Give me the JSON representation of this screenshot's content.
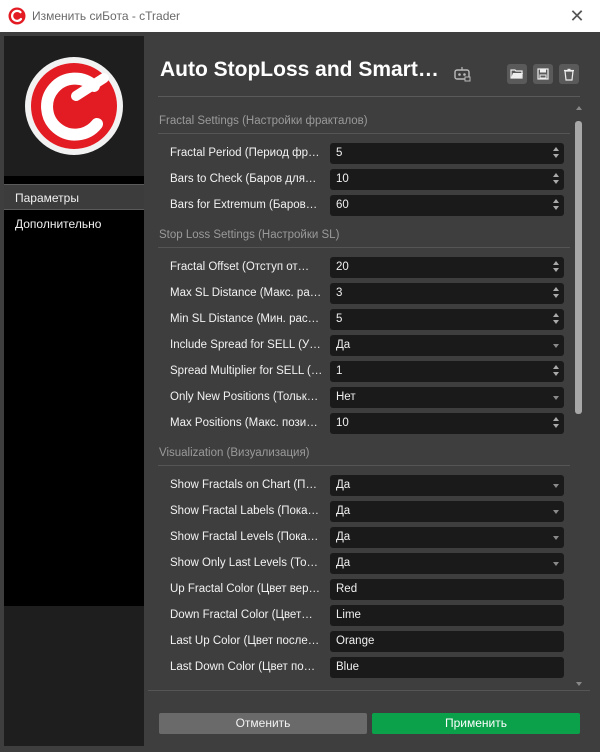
{
  "window": {
    "title": "Изменить сиБота - cTrader"
  },
  "sidebar": {
    "items": [
      {
        "label": "Параметры",
        "active": true
      },
      {
        "label": "Дополнительно",
        "active": false
      }
    ]
  },
  "header": {
    "title": "Auto StopLoss and Smart…"
  },
  "sections": {
    "fractal": {
      "title": "Fractal Settings (Настройки фракталов)",
      "rows": [
        {
          "label": "Fractal Period (Период фра…",
          "value": "5",
          "control": "spin"
        },
        {
          "label": "Bars to Check (Баров для…",
          "value": "10",
          "control": "spin"
        },
        {
          "label": "Bars for Extremum (Баров…",
          "value": "60",
          "control": "spin"
        }
      ]
    },
    "stoploss": {
      "title": "Stop Loss Settings (Настройки SL)",
      "rows": [
        {
          "label": "Fractal Offset (Отступ от…",
          "value": "20",
          "control": "spin"
        },
        {
          "label": "Max SL Distance (Макс. ра…",
          "value": "3",
          "control": "spin"
        },
        {
          "label": "Min SL Distance (Мин. рас…",
          "value": "5",
          "control": "spin"
        },
        {
          "label": "Include Spread for SELL (У…",
          "value": "Да",
          "control": "select"
        },
        {
          "label": "Spread Multiplier for SELL (…",
          "value": "1",
          "control": "spin"
        },
        {
          "label": "Only New Positions (Тольк…",
          "value": "Нет",
          "control": "select"
        },
        {
          "label": "Max Positions (Макс. позиц…",
          "value": "10",
          "control": "spin"
        }
      ]
    },
    "visualization": {
      "title": "Visualization (Визуализация)",
      "rows": [
        {
          "label": "Show Fractals on Chart (П…",
          "value": "Да",
          "control": "select"
        },
        {
          "label": "Show Fractal Labels (Пока…",
          "value": "Да",
          "control": "select"
        },
        {
          "label": "Show Fractal Levels (Пока…",
          "value": "Да",
          "control": "select"
        },
        {
          "label": "Show Only Last Levels (То…",
          "value": "Да",
          "control": "select"
        },
        {
          "label": "Up Fractal Color (Цвет вер…",
          "value": "Red",
          "control": "text"
        },
        {
          "label": "Down Fractal Color (Цвет…",
          "value": "Lime",
          "control": "text"
        },
        {
          "label": "Last Up Color (Цвет после…",
          "value": "Orange",
          "control": "text"
        },
        {
          "label": "Last Down Color (Цвет по…",
          "value": "Blue",
          "control": "text"
        }
      ]
    }
  },
  "footer": {
    "cancel_label": "Отменить",
    "apply_label": "Применить"
  },
  "colors": {
    "accent": "#0aa14a",
    "brand": "#e31b23",
    "panel": "#3e3e3e",
    "field": "#1a1a1a"
  },
  "icons": {
    "logo": "ctrader-logo-icon",
    "bot": "robot-icon",
    "open": "folder-open-icon",
    "save": "save-icon",
    "delete": "trash-icon",
    "close": "close-icon"
  }
}
